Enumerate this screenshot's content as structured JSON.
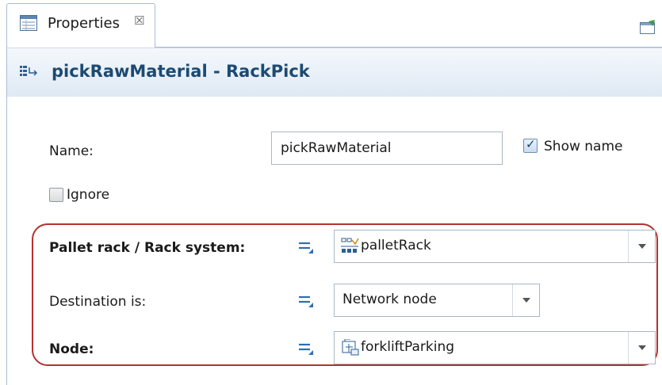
{
  "tab": {
    "title": "Properties",
    "close_glyph": "☒",
    "icon": "properties-icon"
  },
  "header": {
    "title": "pickRawMaterial - RackPick",
    "icon": "block-object-icon"
  },
  "form": {
    "name_label": "Name:",
    "name_value": "pickRawMaterial",
    "show_name_label": "Show name",
    "show_name_checked": true,
    "ignore_label": "Ignore",
    "ignore_checked": false,
    "rack_label": "Pallet rack / Rack system:",
    "rack_value": "palletRack",
    "destination_label": "Destination is:",
    "destination_value": "Network node",
    "node_label": "Node:",
    "node_value": "forkliftParking"
  },
  "colors": {
    "accent_title": "#1c4a72",
    "highlight_border": "#b3322f",
    "tab_border": "#a9bdd3"
  }
}
